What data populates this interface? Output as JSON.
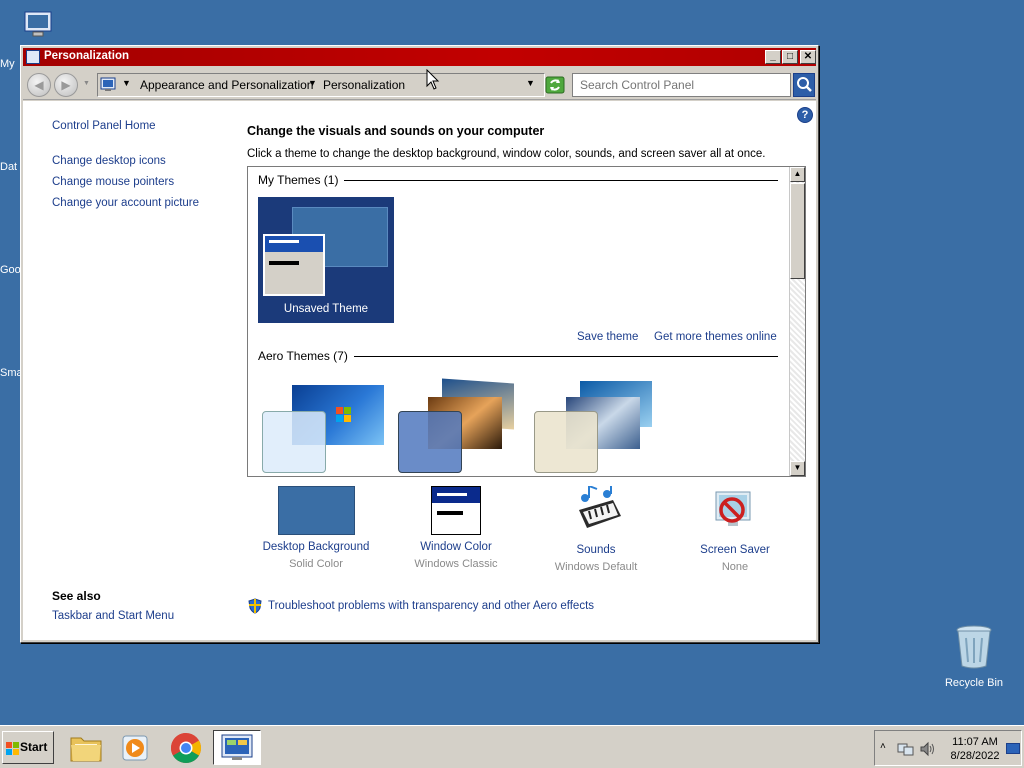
{
  "desktop": {
    "icons": [
      {
        "label": "My",
        "icon": "computer-icon"
      },
      {
        "label": "Dat",
        "icon": "file-icon"
      },
      {
        "label": "Goo",
        "icon": "chrome-icon"
      },
      {
        "label": "Sma",
        "icon": "file-icon"
      }
    ],
    "recycle_bin": "Recycle Bin"
  },
  "window": {
    "title": "Personalization",
    "controls": {
      "minimize": "_",
      "maximize": "□",
      "close": "✕"
    }
  },
  "address": {
    "crumbs": [
      "Appearance and Personalization",
      "Personalization"
    ],
    "search_placeholder": "Search Control Panel"
  },
  "sidebar": {
    "home": "Control Panel Home",
    "links": [
      "Change desktop icons",
      "Change mouse pointers",
      "Change your account picture"
    ],
    "see_also_heading": "See also",
    "see_also_links": [
      "Taskbar and Start Menu"
    ]
  },
  "main": {
    "heading": "Change the visuals and sounds on your computer",
    "subheading": "Click a theme to change the desktop background, window color, sounds, and screen saver all at once.",
    "my_themes_label": "My Themes (1)",
    "unsaved_theme": "Unsaved Theme",
    "save_theme": "Save theme",
    "get_more": "Get more themes online",
    "aero_label": "Aero Themes (7)",
    "bottom_items": [
      {
        "label": "Desktop Background",
        "sub": "Solid Color",
        "icon": "desktop-background-icon"
      },
      {
        "label": "Window Color",
        "sub": "Windows Classic",
        "icon": "window-color-icon"
      },
      {
        "label": "Sounds",
        "sub": "Windows Default",
        "icon": "sounds-icon"
      },
      {
        "label": "Screen Saver",
        "sub": "None",
        "icon": "screen-saver-icon"
      }
    ],
    "troubleshoot": "Troubleshoot problems with transparency and other Aero effects"
  },
  "taskbar": {
    "start_label": "Start",
    "time": "11:07 AM",
    "date": "8/28/2022"
  }
}
